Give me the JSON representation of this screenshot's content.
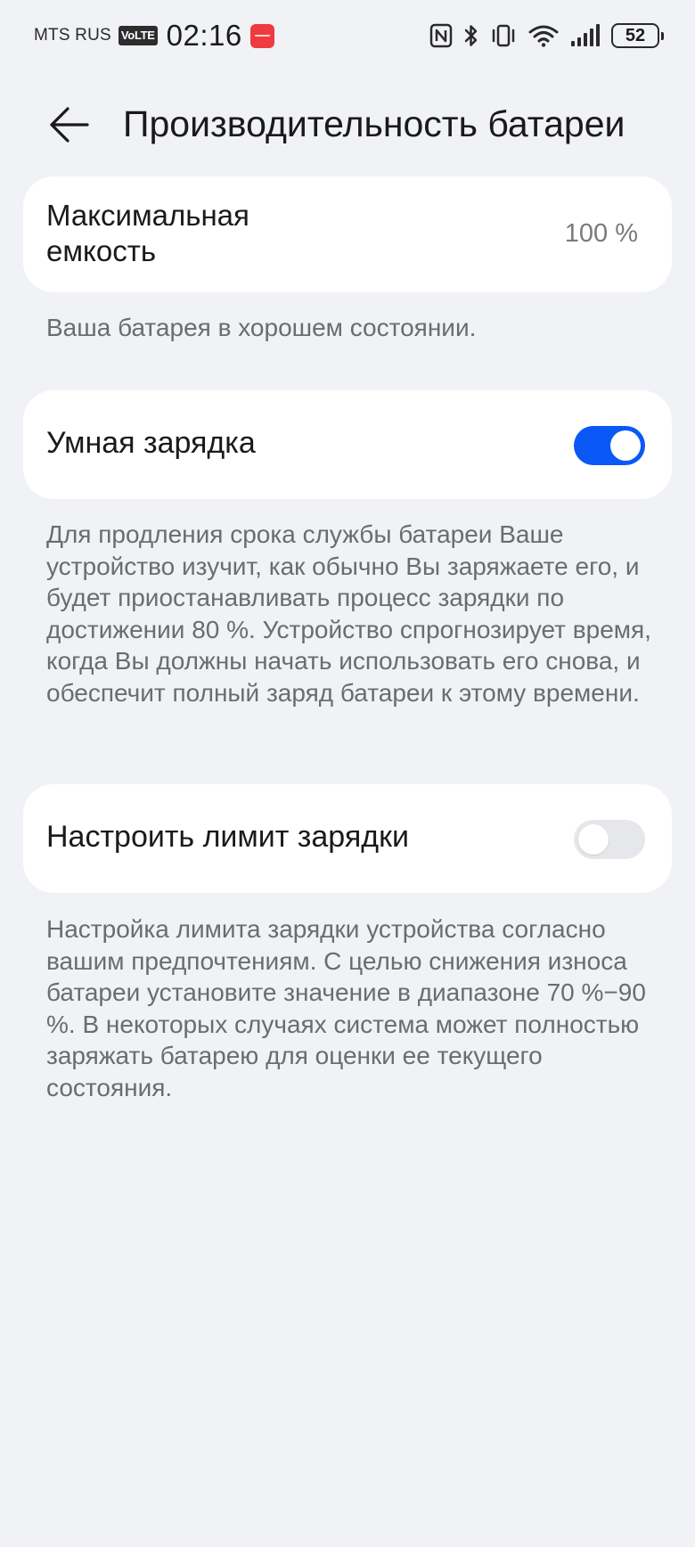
{
  "status_bar": {
    "carrier": "MTS RUS",
    "volte": "VoLTE",
    "time": "02:16",
    "battery_level": "52",
    "icons": [
      "huawei-appgallery-icon",
      "nfc-icon",
      "bluetooth-icon",
      "vibrate-icon",
      "wifi-icon",
      "signal-icon",
      "battery-icon"
    ]
  },
  "header": {
    "title": "Производительность батареи",
    "back_icon": "arrow-left-icon"
  },
  "capacity": {
    "label": "Максимальная емкость",
    "value": "100 %",
    "description": "Ваша батарея в хорошем состоянии."
  },
  "smart_charging": {
    "label": "Умная зарядка",
    "enabled": true,
    "description": "Для продления срока службы батареи Ваше устройство изучит, как обычно Вы заряжаете его, и будет приостанавливать процесс зарядки по достижении 80 %. Устройство спрогнозирует время, когда Вы должны начать использовать его снова, и обеспечит полный заряд батареи к этому времени."
  },
  "charge_limit": {
    "label": "Настроить лимит зарядки",
    "enabled": false,
    "description": "Настройка лимита зарядки устройства согласно вашим предпочтениям. С целью снижения износа батареи установите значение в диапазоне 70 %−90 %. В некоторых случаях система может полностью заряжать батарею для оценки ее текущего состояния."
  },
  "colors": {
    "accent": "#0a59f7",
    "background": "#f1f2f5",
    "card": "#ffffff",
    "secondary_text": "#6b6c70"
  }
}
